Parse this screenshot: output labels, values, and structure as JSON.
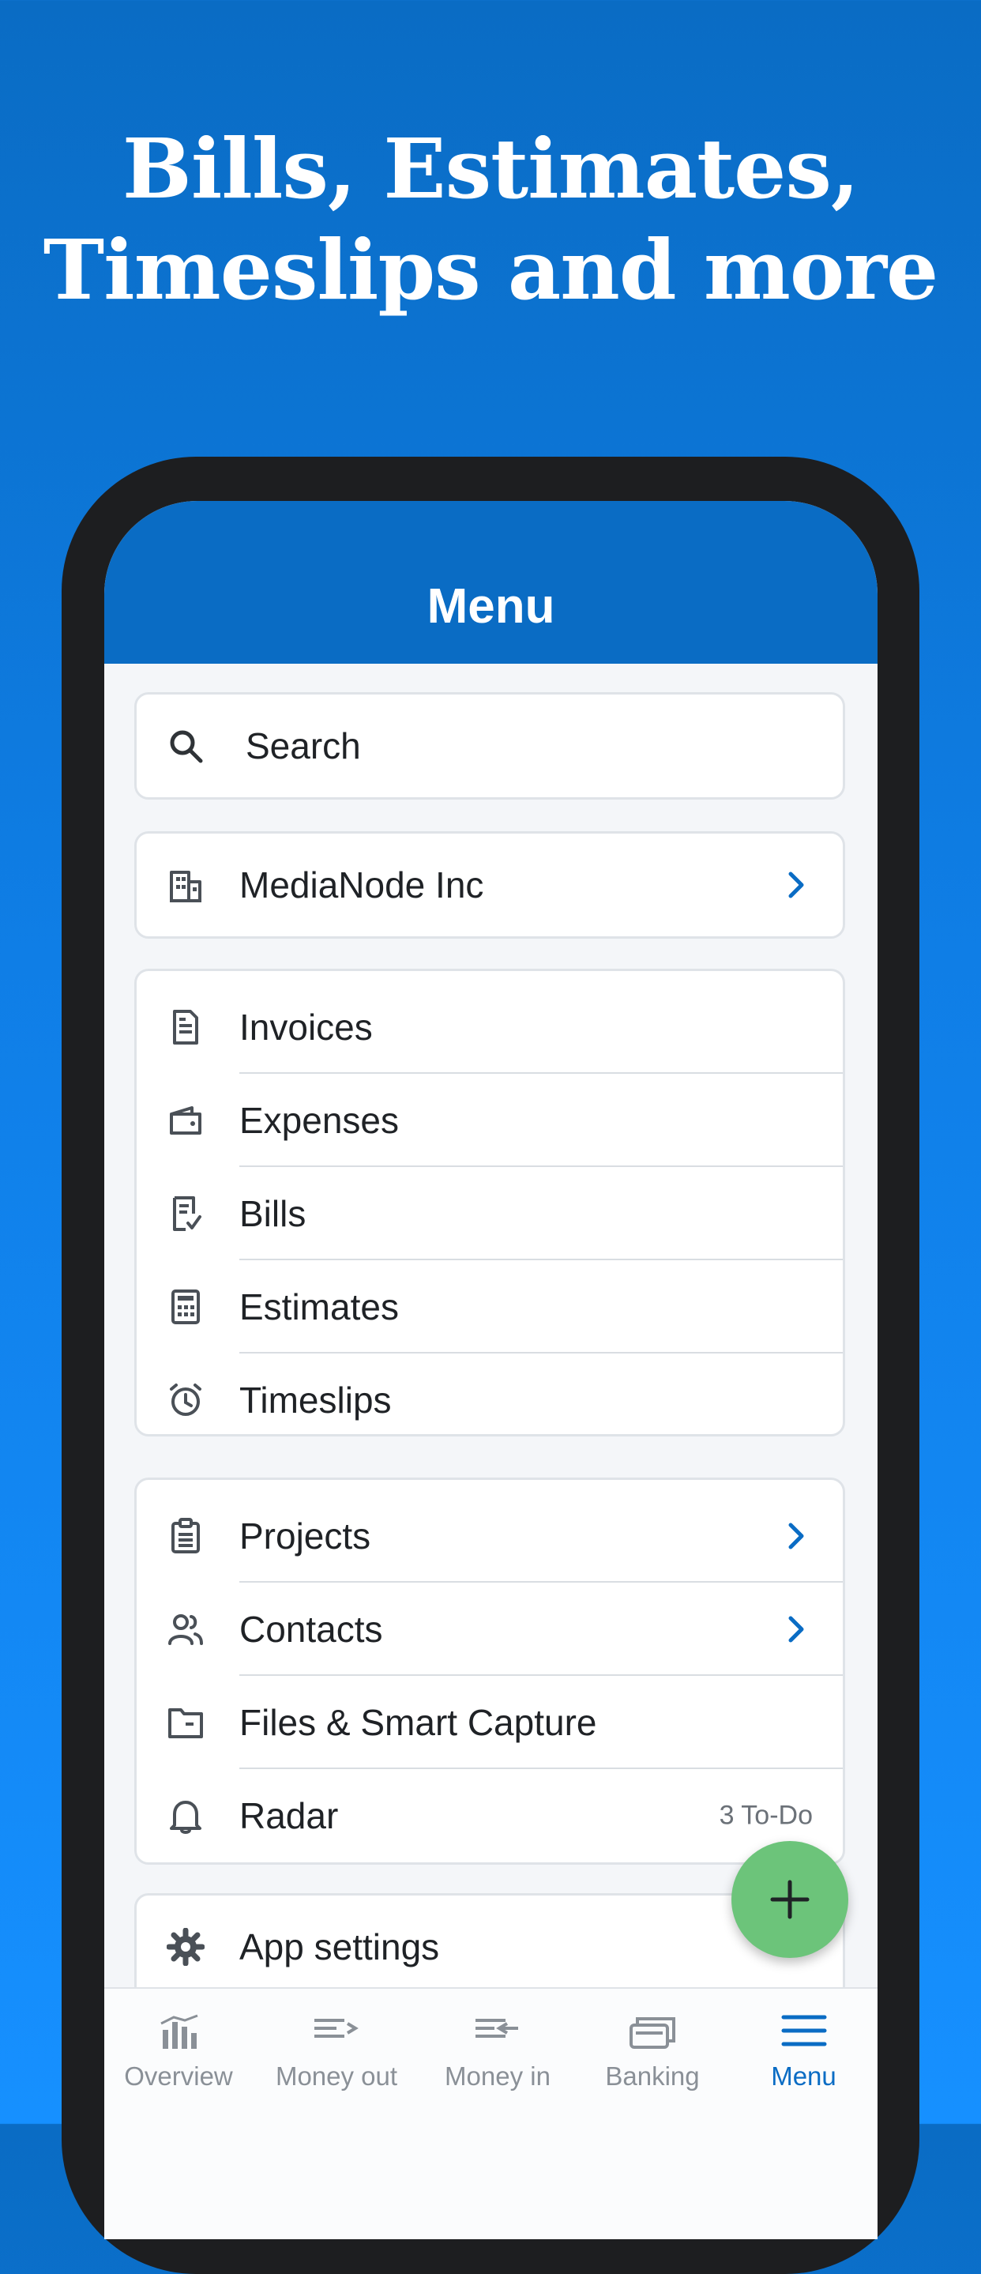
{
  "headline": {
    "line1": "Bills, Estimates,",
    "line2": "Timeslips and more"
  },
  "menu": {
    "title": "Menu"
  },
  "search": {
    "label": "Search",
    "icon": "search-icon"
  },
  "company": {
    "name": "MediaNode Inc",
    "icon": "building-icon"
  },
  "group1": [
    {
      "label": "Invoices",
      "icon": "invoice-icon"
    },
    {
      "label": "Expenses",
      "icon": "wallet-icon"
    },
    {
      "label": "Bills",
      "icon": "bill-check-icon"
    },
    {
      "label": "Estimates",
      "icon": "calculator-icon"
    },
    {
      "label": "Timeslips",
      "icon": "alarm-clock-icon"
    }
  ],
  "group2": [
    {
      "label": "Projects",
      "icon": "clipboard-icon"
    },
    {
      "label": "Contacts",
      "icon": "contacts-icon"
    },
    {
      "label": "Files & Smart Capture",
      "icon": "folder-icon"
    },
    {
      "label": "Radar",
      "icon": "bell-icon",
      "aside": "3 To-Do"
    }
  ],
  "settings": {
    "label": "App settings",
    "icon": "gear-icon"
  },
  "tabs": [
    {
      "label": "Overview",
      "icon": "bar-chart-icon"
    },
    {
      "label": "Money out",
      "icon": "money-out-icon"
    },
    {
      "label": "Money in",
      "icon": "money-in-icon"
    },
    {
      "label": "Banking",
      "icon": "banking-icon"
    },
    {
      "label": "Menu",
      "icon": "hamburger-icon",
      "active": true
    }
  ],
  "colors": {
    "brand_blue": "#0a6cc4",
    "fab_green": "#6cc47a",
    "text": "#1f2226",
    "muted": "#8a9097"
  }
}
